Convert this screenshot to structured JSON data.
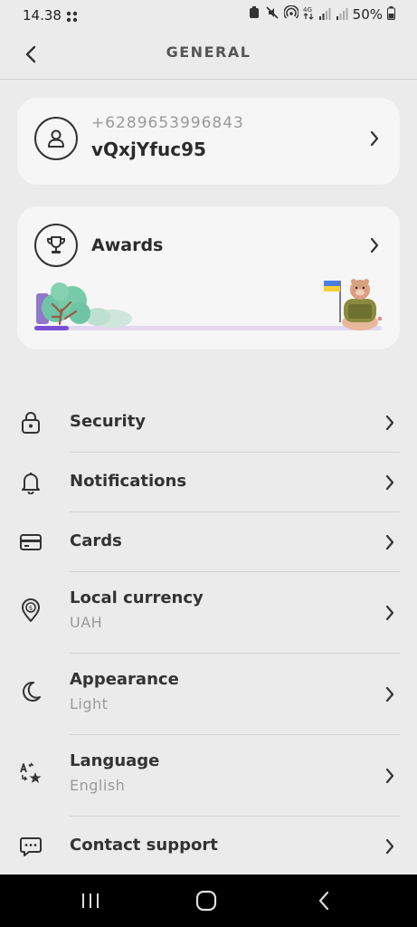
{
  "status_bar": {
    "time": "14.38",
    "battery": "50%"
  },
  "header": {
    "title": "GENERAL"
  },
  "profile": {
    "phone": "+6289653996843",
    "username": "vQxjYfuc95"
  },
  "awards": {
    "label": "Awards"
  },
  "menu": {
    "items": [
      {
        "label": "Security"
      },
      {
        "label": "Notifications"
      },
      {
        "label": "Cards"
      },
      {
        "label": "Local currency",
        "value": "UAH"
      },
      {
        "label": "Appearance",
        "value": "Light"
      },
      {
        "label": "Language",
        "value": "English"
      },
      {
        "label": "Contact support"
      }
    ]
  },
  "colors": {
    "background": "#ebebeb",
    "card": "#f6f6f6",
    "accent": "#7b4fd6",
    "text": "#333333"
  }
}
